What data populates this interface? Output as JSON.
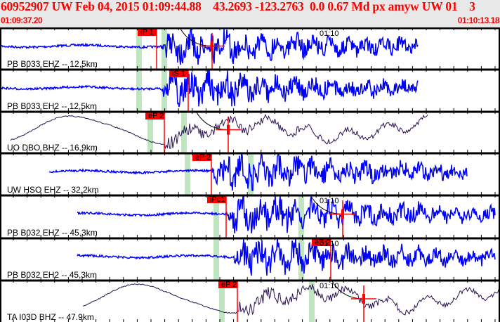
{
  "header": {
    "title": "60952907 UW Feb 04, 2015 01:09:44.88    43.2693 -123.2763  0.0 0.67 Md px amyw UW 01    3",
    "time_start": "01:09:37.20",
    "time_end": "01:10:13.18"
  },
  "colors": {
    "header_text": "#ff0000",
    "pick": "#ff0000",
    "band": "#bfe6c0",
    "trace_short": "#0000ff",
    "trace_broadband": "#2a1050",
    "header_bg": "#e8e8e8"
  },
  "minute_label": "01:10",
  "channels": [
    {
      "label": "PB B033 EHZ -- 12,5km",
      "pick": "iP 1",
      "type": "short",
      "show_time": true
    },
    {
      "label": "PB B033 EH2 -- 12,5km",
      "pick": "iS 1",
      "type": "short",
      "show_time": false
    },
    {
      "label": "UO DBO BHZ -- 16,9km",
      "pick": "eP 2",
      "type": "broadband",
      "show_time": false
    },
    {
      "label": "UW HSO EHZ -- 32,2km",
      "pick": "eP 2",
      "type": "short",
      "show_time": false
    },
    {
      "label": "PB B032 EHZ -- 45,3km",
      "pick": "iPc1",
      "type": "short",
      "show_time": true
    },
    {
      "label": "PB B032 EH2 -- 45,3km",
      "pick": "eS 2",
      "type": "short",
      "show_time": true
    },
    {
      "label": "TA I03D BHZ -- 47.9km",
      "pick": "eP 2",
      "type": "broadband",
      "show_time": true
    }
  ]
}
